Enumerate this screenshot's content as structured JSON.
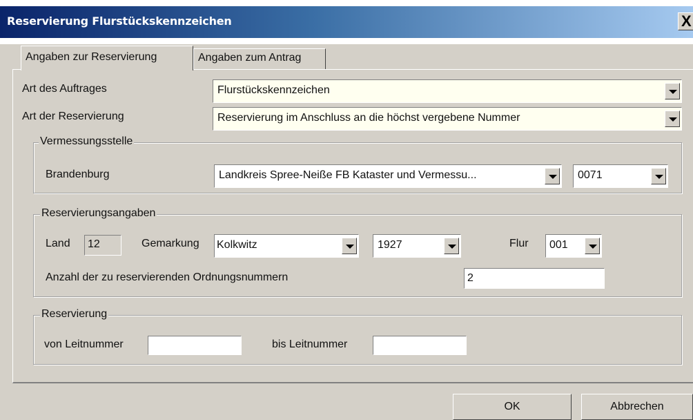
{
  "window": {
    "title": "Reservierung Flurstückskennzeichen",
    "close_glyph": "X"
  },
  "tabs": [
    {
      "label": "Angaben zur Reservierung",
      "active": true
    },
    {
      "label": "Angaben zum Antrag",
      "active": false
    }
  ],
  "auftrag": {
    "label": "Art des Auftrages",
    "value": "Flurstückskennzeichen"
  },
  "reservierung_art": {
    "label": "Art der Reservierung",
    "value": "Reservierung im Anschluss an die höchst vergebene Nummer"
  },
  "vermessungsstelle": {
    "legend": "Vermessungsstelle",
    "label": "Brandenburg",
    "stelle_value": "Landkreis Spree-Neiße FB Kataster und Vermessu...",
    "code_value": "0071"
  },
  "reservierungsangaben": {
    "legend": "Reservierungsangaben",
    "land_label": "Land",
    "land_value": "12",
    "gemarkung_label": "Gemarkung",
    "gemarkung_value": "Kolkwitz",
    "gemarkung_nr": "1927",
    "flur_label": "Flur",
    "flur_value": "001",
    "anzahl_label": "Anzahl der zu reservierenden Ordnungsnummern",
    "anzahl_value": "2"
  },
  "reservierung": {
    "legend": "Reservierung",
    "von_label": "von Leitnummer",
    "von_value": "",
    "bis_label": "bis Leitnummer",
    "bis_value": ""
  },
  "buttons": {
    "ok": "OK",
    "cancel": "Abbrechen"
  },
  "colors": {
    "titlebar_start": "#0a246a",
    "titlebar_end": "#a6caf0",
    "dialog_bg": "#d4d0c8",
    "combo_highlight": "#fffff0"
  }
}
